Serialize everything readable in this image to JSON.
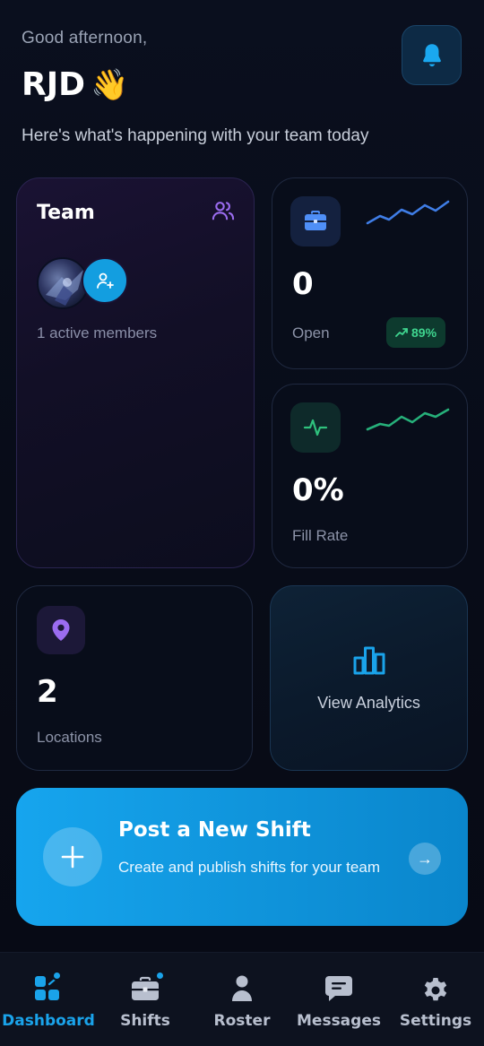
{
  "header": {
    "greeting": "Good afternoon,",
    "username": "RJD",
    "wave_emoji": "👋",
    "subtitle": "Here's what's happening with your team today",
    "notification_icon": "bell-icon"
  },
  "team_card": {
    "title": "Team",
    "members_text": "1 active members"
  },
  "open_card": {
    "value": "0",
    "label": "Open",
    "trend": "89%",
    "icon": "briefcase-icon"
  },
  "fill_card": {
    "value": "0%",
    "label": "Fill Rate",
    "icon": "activity-icon"
  },
  "locations_card": {
    "value": "2",
    "label": "Locations",
    "icon": "map-pin-icon"
  },
  "analytics_card": {
    "label": "View Analytics",
    "icon": "bar-chart-icon"
  },
  "post_shift": {
    "title": "Post a New Shift",
    "description": "Create and publish shifts for your team",
    "arrow": "→"
  },
  "nav": {
    "items": [
      {
        "label": "Dashboard",
        "icon": "dashboard-icon",
        "active": true
      },
      {
        "label": "Shifts",
        "icon": "briefcase-icon",
        "active": false
      },
      {
        "label": "Roster",
        "icon": "person-icon",
        "active": false
      },
      {
        "label": "Messages",
        "icon": "message-icon",
        "active": false
      },
      {
        "label": "Settings",
        "icon": "gear-icon",
        "active": false
      }
    ]
  },
  "colors": {
    "accent": "#1aa3ea",
    "background": "#0a0f1e",
    "success": "#3fd58f",
    "purple": "#9b6cf0"
  }
}
